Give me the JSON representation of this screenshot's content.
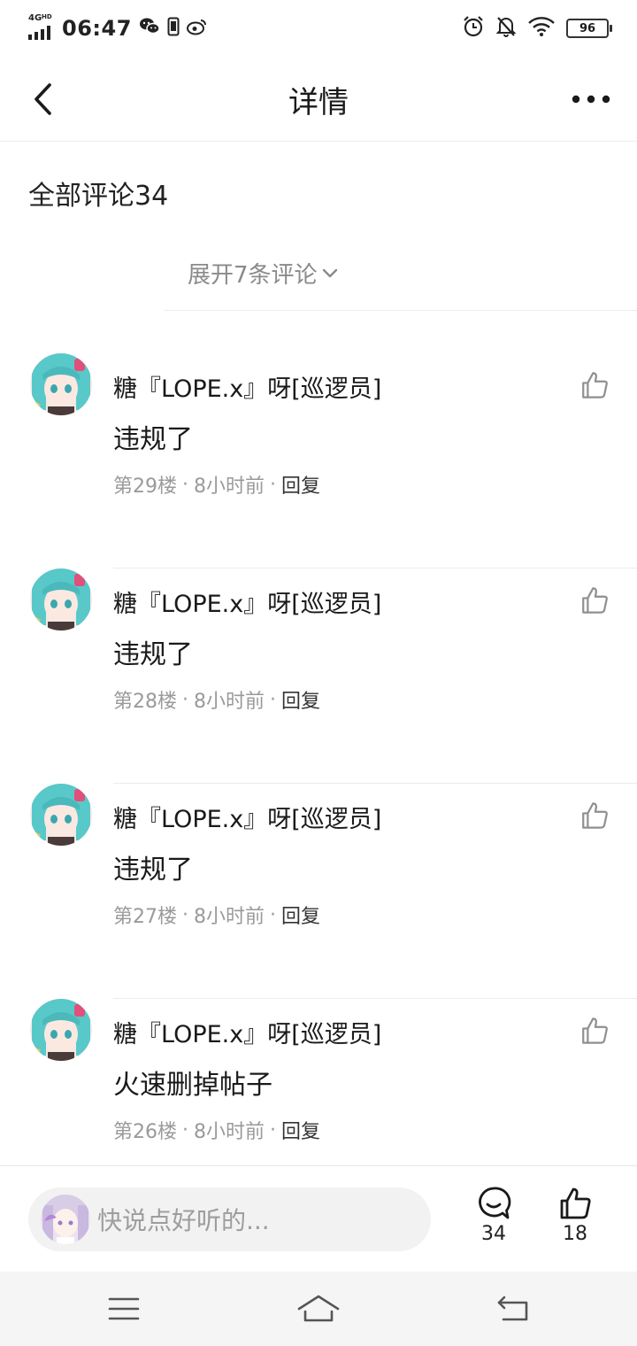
{
  "status_bar": {
    "network": "4G",
    "network_sub": "HD",
    "time": "06:47",
    "battery": "96"
  },
  "header": {
    "title": "详情"
  },
  "comments_section": {
    "title": "全部评论34",
    "expand_label": "展开7条评论"
  },
  "comments": [
    {
      "name": "糖『LOPE.x』呀[巡逻员]",
      "text": "违规了",
      "floor": "第29楼",
      "time": "8小时前",
      "reply": "回复"
    },
    {
      "name": "糖『LOPE.x』呀[巡逻员]",
      "text": "违规了",
      "floor": "第28楼",
      "time": "8小时前",
      "reply": "回复"
    },
    {
      "name": "糖『LOPE.x』呀[巡逻员]",
      "text": "违规了",
      "floor": "第27楼",
      "time": "8小时前",
      "reply": "回复"
    },
    {
      "name": "糖『LOPE.x』呀[巡逻员]",
      "text": "火速删掉帖子",
      "floor": "第26楼",
      "time": "8小时前",
      "reply": "回复"
    }
  ],
  "bottom_bar": {
    "input_placeholder": "快说点好听的...",
    "comment_count": "34",
    "like_count": "18"
  },
  "colors": {
    "muted_text": "#9a9a9a",
    "divider": "#ececec",
    "avatar_hair": "#59c8c9"
  }
}
